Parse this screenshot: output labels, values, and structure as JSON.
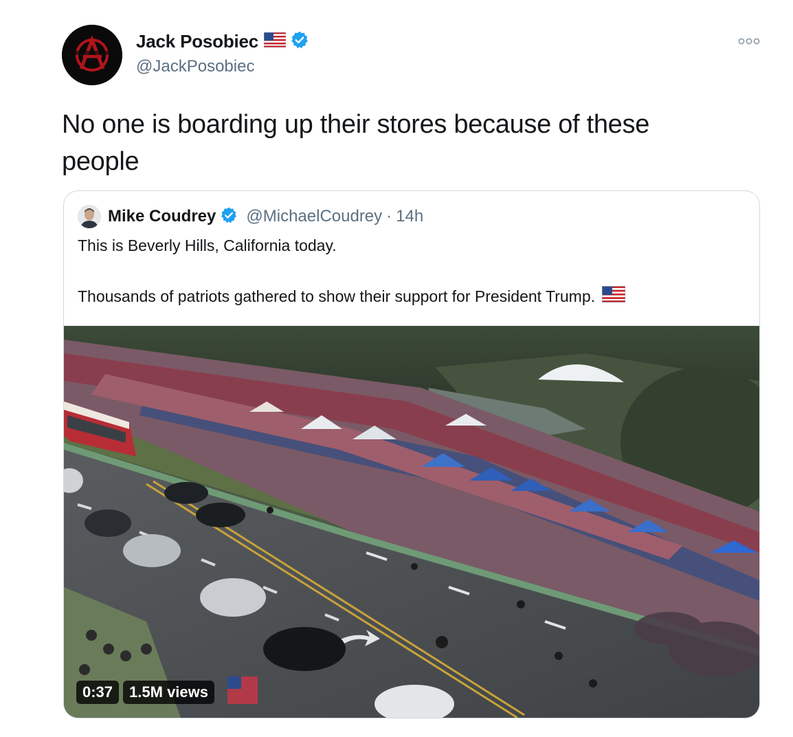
{
  "tweet": {
    "author": {
      "display_name": "Jack Posobiec",
      "handle": "@JackPosobiec",
      "avatar_icon": "anarchy-logo-avatar",
      "flag_icon": "us-flag-icon",
      "verified_icon": "verified-badge-icon"
    },
    "more_icon": "more-options-icon",
    "text": "No one is boarding up their stores because of these people"
  },
  "quoted_tweet": {
    "author": {
      "display_name": "Mike Coudrey",
      "handle": "@MichaelCoudrey",
      "separator": "·",
      "time": "14h",
      "avatar_icon": "profile-photo-avatar",
      "verified_icon": "verified-badge-icon"
    },
    "text_line1": "This is Beverly Hills, California today.",
    "text_line2": "Thousands of patriots gathered to show their support for President Trump.",
    "flag_icon": "us-flag-icon",
    "media": {
      "type": "video",
      "description_icon": "aerial-rally-video-thumbnail",
      "duration": "0:37",
      "views": "1.5M views"
    }
  },
  "colors": {
    "verified_blue": "#1da1f2",
    "secondary_text": "#5b7083",
    "card_border": "#cfd9de"
  }
}
